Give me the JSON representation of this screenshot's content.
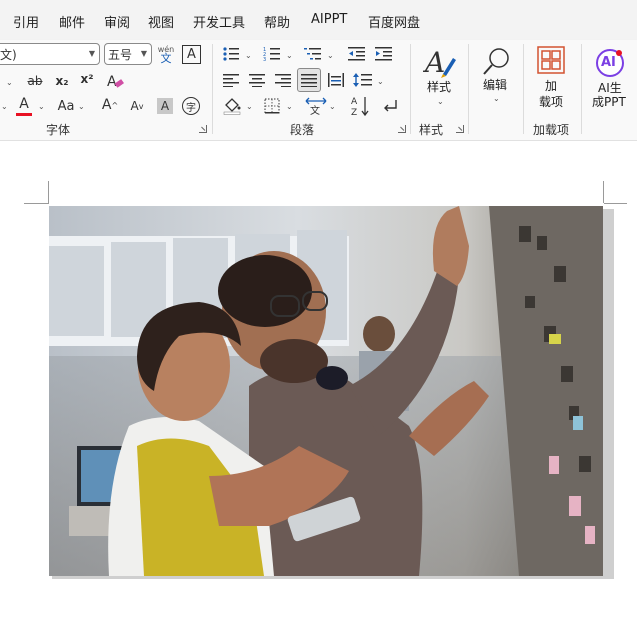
{
  "tabs": [
    "引用",
    "邮件",
    "审阅",
    "视图",
    "开发工具",
    "帮助",
    "AIPPT",
    "百度网盘"
  ],
  "font": {
    "name_value": "文)",
    "size_value": "五号",
    "pinyin_top": "wén",
    "pinyin_bottom": "文",
    "border_char": "A",
    "subscript": "x₂",
    "superscript": "x²",
    "font_color_letter": "A",
    "change_case": "Aa",
    "grow": "A",
    "shrink": "A",
    "shading_letter": "A",
    "enclose_char": "字",
    "strike": "ab",
    "label": "字体"
  },
  "paragraph": {
    "label": "段落"
  },
  "styles": {
    "button_label": "样式",
    "label": "样式"
  },
  "editing": {
    "button_label": "编辑"
  },
  "addins": {
    "button_line1": "加",
    "button_line2": "载项",
    "label": "加载项"
  },
  "ai": {
    "logo": "AI",
    "line1": "AI生",
    "line2": "成PPT"
  },
  "colors": {
    "accent_red": "#e81123",
    "ai_purple": "#7b3fe4",
    "addins_orange": "#d35230"
  }
}
